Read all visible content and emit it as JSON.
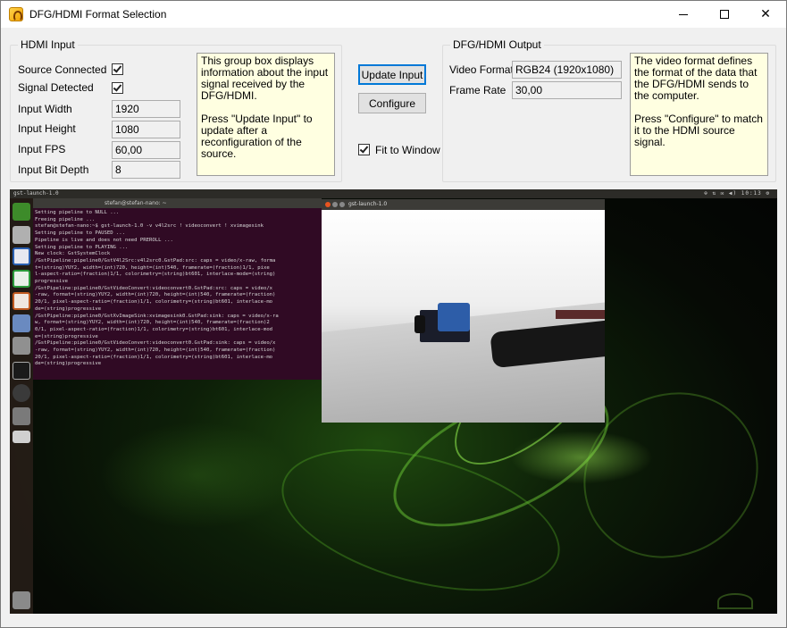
{
  "window": {
    "title": "DFG/HDMI Format Selection",
    "minimize_symbol": "",
    "maximize_symbol": "",
    "close_symbol": "✕"
  },
  "hdmi_input": {
    "group_title": "HDMI Input",
    "source_connected": {
      "label": "Source Connected",
      "checked": true
    },
    "signal_detected": {
      "label": "Signal Detected",
      "checked": true
    },
    "input_width": {
      "label": "Input Width",
      "value": "1920"
    },
    "input_height": {
      "label": "Input Height",
      "value": "1080"
    },
    "input_fps": {
      "label": "Input FPS",
      "value": "60,00"
    },
    "input_bit_depth": {
      "label": "Input Bit Depth",
      "value": "8"
    },
    "note": "This group box displays information about the input signal received by the DFG/HDMI.\n\nPress \"Update Input\" to update after a reconfiguration of the source."
  },
  "actions": {
    "update_input": "Update Input",
    "configure": "Configure",
    "fit_to_window": {
      "label": "Fit to Window",
      "checked": true
    }
  },
  "dfg_output": {
    "group_title": "DFG/HDMI Output",
    "video_format": {
      "label": "Video Format",
      "value": "RGB24 (1920x1080)"
    },
    "frame_rate": {
      "label": "Frame Rate",
      "value": "30,00"
    },
    "note": "The video format defines the format of the data that the DFG/HDMI sends to the computer.\n\nPress \"Configure\" to match it to the HDMI source signal."
  },
  "video": {
    "topbar_title": "gst-launch-1.0",
    "topbar_status": "⊕ ⇅ ✉ ◀) 10:13 ⚙",
    "terminal_title": "stefan@stefan-nano: ~",
    "terminal_lines": [
      "Setting pipeline to NULL ...",
      "Freeing pipeline ...",
      "stefan@stefan-nano:~$ gst-launch-1.0 -v v4l2src ! videoconvert ! xvimagesink",
      "Setting pipeline to PAUSED ...",
      "Pipeline is live and does not need PREROLL ...",
      "Setting pipeline to PLAYING ...",
      "New clock: GstSystemClock",
      "/GstPipeline:pipeline0/GstV4l2Src:v4l2src0.GstPad:src: caps = video/x-raw, forma",
      "t=(string)YUY2, width=(int)720, height=(int)540, framerate=(fraction)1/1, pixe",
      "l-aspect-ratio=(fraction)1/1, colorimetry=(string)bt601, interlace-mode=(string)",
      "progressive",
      "/GstPipeline:pipeline0/GstVideoConvert:videoconvert0.GstPad:src: caps = video/x",
      "-raw, format=(string)YUY2, width=(int)720, height=(int)540, framerate=(fraction)",
      "20/1, pixel-aspect-ratio=(fraction)1/1, colorimetry=(string)bt601, interlace-mo",
      "de=(string)progressive",
      "/GstPipeline:pipeline0/GstXvImageSink:xvimagesink0.GstPad:sink: caps = video/x-ra",
      "w, format=(string)YUY2, width=(int)720, height=(int)540, framerate=(fraction)2",
      "0/1, pixel-aspect-ratio=(fraction)1/1, colorimetry=(string)bt601, interlace-mod",
      "e=(string)progressive",
      "/GstPipeline:pipeline0/GstVideoConvert:videoconvert0.GstPad:sink: caps = video/x",
      "-raw, format=(string)YUY2, width=(int)720, height=(int)540, framerate=(fraction)",
      "20/1, pixel-aspect-ratio=(fraction)1/1, colorimetry=(string)bt601, interlace-mo",
      "de=(string)progressive"
    ],
    "gst_window_title": "gst-launch-1.0"
  }
}
